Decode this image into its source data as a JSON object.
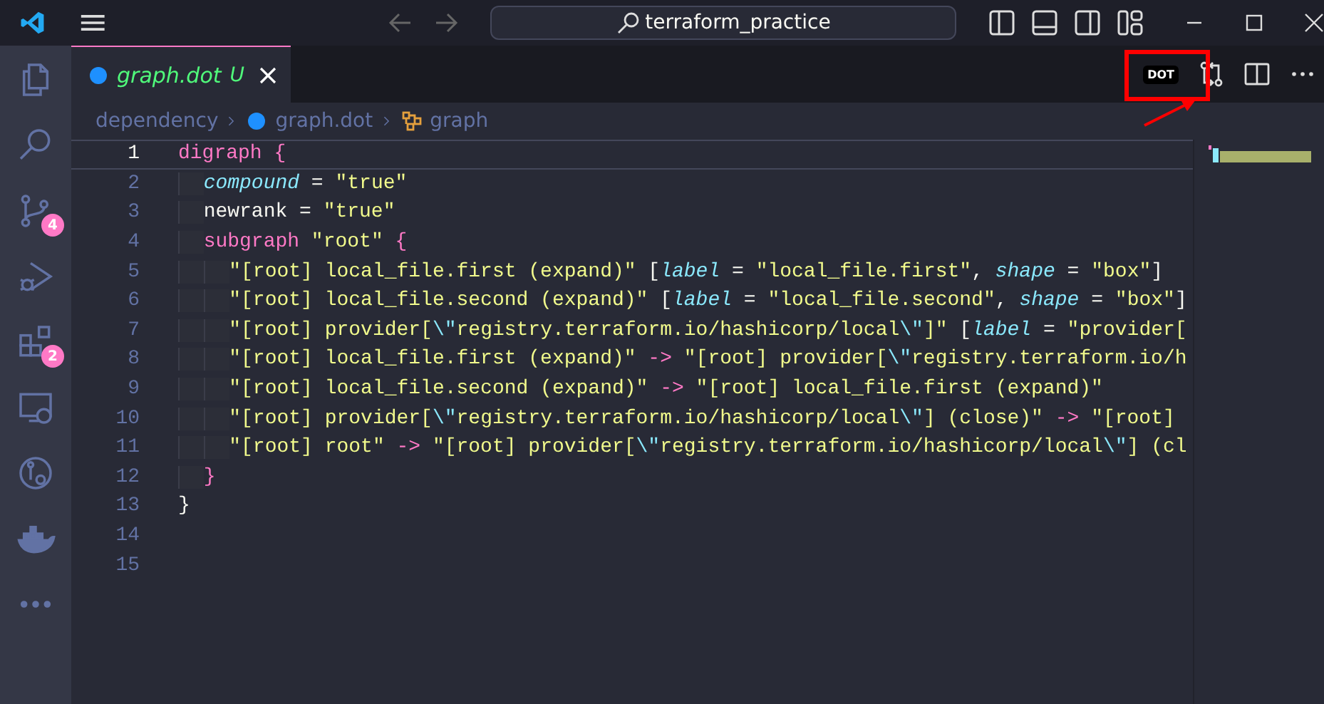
{
  "title_bar": {
    "search_text": "terraform_practice"
  },
  "activity_bar": {
    "items": [
      {
        "kind": "files",
        "selected": false
      },
      {
        "kind": "search",
        "selected": false
      },
      {
        "kind": "source-control",
        "selected": false,
        "badge": "4"
      },
      {
        "kind": "run",
        "selected": false
      },
      {
        "kind": "extensions",
        "selected": false,
        "badge": "2"
      },
      {
        "kind": "remote",
        "selected": false
      },
      {
        "kind": "timeline",
        "selected": false
      },
      {
        "kind": "docker",
        "selected": false
      },
      {
        "kind": "more",
        "selected": false
      }
    ]
  },
  "tabs": [
    {
      "label": "graph.dot",
      "status": "U",
      "selected": true
    }
  ],
  "editor_actions": {
    "dot_badge": "DOT",
    "annotated": true
  },
  "breadcrumbs": [
    {
      "label": "dependency",
      "kind": "folder"
    },
    {
      "label": "graph.dot",
      "kind": "file"
    },
    {
      "label": "graph",
      "kind": "symbol"
    }
  ],
  "code_lines": [
    {
      "number": "1",
      "tokens": [
        {
          "kind": "keyword",
          "text": "digraph"
        },
        {
          "kind": "bracket",
          "text": " {"
        }
      ],
      "children": [
        {
          "number": "2",
          "tokens": [
            {
              "kind": "attr",
              "text": "compound"
            },
            {
              "kind": "plain",
              "text": " = "
            },
            {
              "kind": "string",
              "text": "\"true\""
            }
          ]
        },
        {
          "number": "3",
          "tokens": [
            {
              "kind": "plain",
              "text": "newrank = "
            },
            {
              "kind": "string",
              "text": "\"true\""
            }
          ]
        },
        {
          "number": "4",
          "tokens": [
            {
              "kind": "keyword",
              "text": "subgraph"
            },
            {
              "kind": "string",
              "text": " \"root\""
            },
            {
              "kind": "bracket",
              "text": " {"
            }
          ],
          "children": [
            {
              "number": "5",
              "tokens": [
                {
                  "kind": "string",
                  "text": "\"[root] local_file.first (expand)\""
                },
                {
                  "kind": "plain",
                  "text": " ["
                },
                {
                  "kind": "attr",
                  "text": "label"
                },
                {
                  "kind": "plain",
                  "text": " = "
                },
                {
                  "kind": "string",
                  "text": "\"local_file.first\""
                },
                {
                  "kind": "plain",
                  "text": ", "
                },
                {
                  "kind": "attr",
                  "text": "shape"
                },
                {
                  "kind": "plain",
                  "text": " = "
                },
                {
                  "kind": "string",
                  "text": "\"box\""
                },
                {
                  "kind": "plain",
                  "text": "]"
                }
              ]
            },
            {
              "number": "6",
              "tokens": [
                {
                  "kind": "string",
                  "text": "\"[root] local_file.second (expand)\""
                },
                {
                  "kind": "plain",
                  "text": " ["
                },
                {
                  "kind": "attr",
                  "text": "label"
                },
                {
                  "kind": "plain",
                  "text": " = "
                },
                {
                  "kind": "string",
                  "text": "\"local_file.second\""
                },
                {
                  "kind": "plain",
                  "text": ", "
                },
                {
                  "kind": "attr",
                  "text": "shape"
                },
                {
                  "kind": "plain",
                  "text": " = "
                },
                {
                  "kind": "string",
                  "text": "\"box\""
                },
                {
                  "kind": "plain",
                  "text": "]"
                }
              ]
            },
            {
              "number": "7",
              "tokens": [
                {
                  "kind": "string",
                  "text": "\"[root] provider["
                },
                {
                  "kind": "escape",
                  "text": "\\\""
                },
                {
                  "kind": "string",
                  "text": "registry.terraform.io/hashicorp/local"
                },
                {
                  "kind": "escape",
                  "text": "\\\""
                },
                {
                  "kind": "string",
                  "text": "]\""
                },
                {
                  "kind": "plain",
                  "text": " ["
                },
                {
                  "kind": "attr",
                  "text": "label"
                },
                {
                  "kind": "plain",
                  "text": " = "
                },
                {
                  "kind": "string",
                  "text": "\"provider["
                }
              ]
            },
            {
              "number": "8",
              "tokens": [
                {
                  "kind": "string",
                  "text": "\"[root] local_file.first (expand)\""
                },
                {
                  "kind": "operator",
                  "text": " -> "
                },
                {
                  "kind": "string",
                  "text": "\"[root] provider["
                },
                {
                  "kind": "escape",
                  "text": "\\\""
                },
                {
                  "kind": "string",
                  "text": "registry.terraform.io/h"
                }
              ]
            },
            {
              "number": "9",
              "tokens": [
                {
                  "kind": "string",
                  "text": "\"[root] local_file.second (expand)\""
                },
                {
                  "kind": "operator",
                  "text": " -> "
                },
                {
                  "kind": "string",
                  "text": "\"[root] local_file.first (expand)\""
                }
              ]
            },
            {
              "number": "10",
              "tokens": [
                {
                  "kind": "string",
                  "text": "\"[root] provider["
                },
                {
                  "kind": "escape",
                  "text": "\\\""
                },
                {
                  "kind": "string",
                  "text": "registry.terraform.io/hashicorp/local"
                },
                {
                  "kind": "escape",
                  "text": "\\\""
                },
                {
                  "kind": "string",
                  "text": "] (close)\""
                },
                {
                  "kind": "operator",
                  "text": " -> "
                },
                {
                  "kind": "string",
                  "text": "\"[root]"
                }
              ]
            },
            {
              "number": "11",
              "tokens": [
                {
                  "kind": "string",
                  "text": "\"[root] root\""
                },
                {
                  "kind": "operator",
                  "text": " -> "
                },
                {
                  "kind": "string",
                  "text": "\"[root] provider["
                },
                {
                  "kind": "escape",
                  "text": "\\\""
                },
                {
                  "kind": "string",
                  "text": "registry.terraform.io/hashicorp/local"
                },
                {
                  "kind": "escape",
                  "text": "\\\""
                },
                {
                  "kind": "string",
                  "text": "] (cl"
                }
              ]
            }
          ]
        },
        {
          "number": "12",
          "tokens": [
            {
              "kind": "bracket",
              "text": "}"
            }
          ]
        }
      ]
    },
    {
      "number": "13",
      "tokens": [
        {
          "kind": "bracket2",
          "text": "}"
        }
      ]
    },
    {
      "number": "14"
    },
    {
      "number": "15"
    }
  ]
}
